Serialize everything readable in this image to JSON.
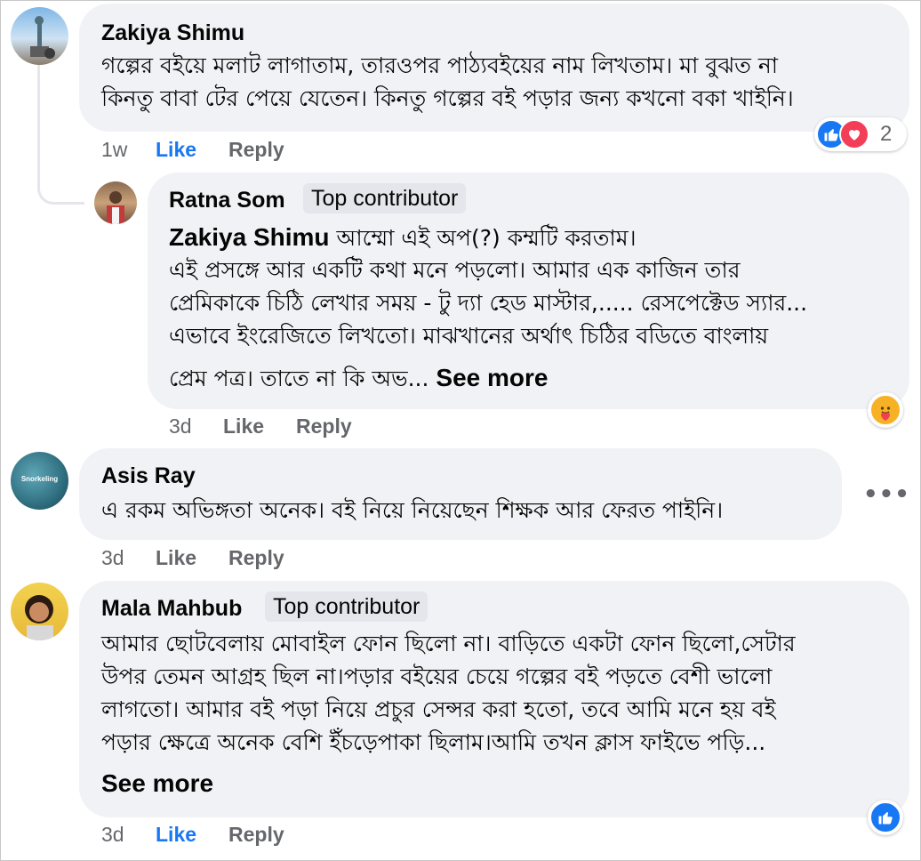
{
  "comments": [
    {
      "author": "Zakiya Shimu",
      "lines": [
        "গল্পের বইয়ে মলাট লাগাতাম, তারওপর পাঠ্যবইয়ের নাম লিখতাম। মা বুঝত না",
        "কিনতু বাবা টের পেয়ে যেতেন। কিনতু গল্পের বই পড়ার জন্য কখনো বকা খাইনি।"
      ],
      "time": "1w",
      "like_label": "Like",
      "reply_label": "Reply",
      "reaction_count": "2",
      "reactions": [
        "like-icon",
        "love-icon"
      ]
    },
    {
      "author": "Ratna Som",
      "badge": "Top contributor",
      "mention": "Zakiya Shimu",
      "first_line_rest": " আম্মো এই অপ(?) কম্মটি করতাম।",
      "lines": [
        "এই প্রসঙ্গে আর একটি কথা মনে পড়লো। আমার এক কাজিন তার",
        "প্রেমিকাকে চিঠি লেখার সময় - টু দ্যা হেড মাস্টার,..... রেসপেক্টেড স্যার...",
        "এভাবে ইংরেজিতে লিখতো। মাঝখানের অর্থাৎ চিঠির বডিতে বাংলায়",
        "প্রেম পত্র। তাতে না কি অভ... "
      ],
      "see_more": "See more",
      "time": "3d",
      "like_label": "Like",
      "reply_label": "Reply",
      "reactions": [
        "care-icon"
      ]
    },
    {
      "author": "Asis Ray",
      "avatar_text": "Snorkeling",
      "lines": [
        "এ রকম অভিঙ্গতা অনেক। বই নিয়ে নিয়েছেন শিক্ষক আর ফেরত পাইনি।"
      ],
      "time": "3d",
      "like_label": "Like",
      "reply_label": "Reply",
      "more_label": "•••"
    },
    {
      "author": "Mala Mahbub",
      "badge": "Top contributor",
      "lines": [
        "আমার ছোটবেলায় মোবাইল ফোন ছিলো না। বাড়িতে একটা ফোন ছিলো,সেটার",
        "উপর তেমন আগ্রহ ছিল না।পড়ার বইয়ের চেয়ে গল্পের বই পড়তে বেশী ভালো",
        "লাগতো। আমার বই পড়া নিয়ে প্রচুর সেন্সর করা হতো, তবে আমি মনে হয় বই",
        "পড়ার ক্ষেত্রে অনেক বেশি ইঁচড়েপাকা ছিলাম।আমি তখন ক্লাস ফাইভে পড়ি..."
      ],
      "see_more": "See more",
      "time": "3d",
      "like_label": "Like",
      "reply_label": "Reply",
      "reactions": [
        "like-icon"
      ]
    }
  ],
  "colors": {
    "bubble": "#f0f2f5",
    "like_active": "#1877f2",
    "secondary_text": "#65676b",
    "love": "#f33e58"
  }
}
